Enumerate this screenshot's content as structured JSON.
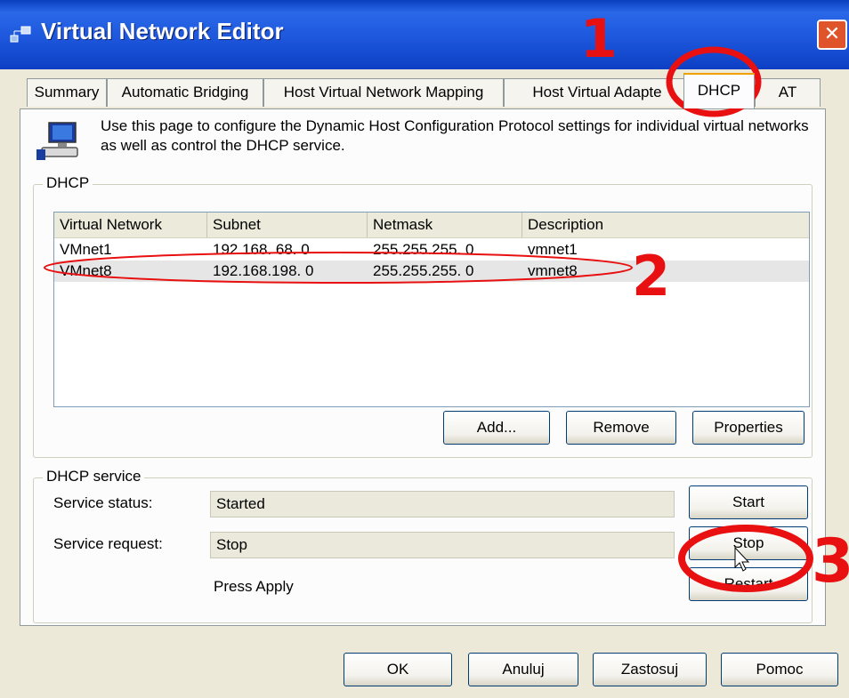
{
  "window": {
    "title": "Virtual Network Editor",
    "icon": "network-icon",
    "close_icon": "close-icon"
  },
  "tabs": [
    {
      "label": "Summary"
    },
    {
      "label": "Automatic Bridging"
    },
    {
      "label": "Host Virtual Network Mapping"
    },
    {
      "label": "Host Virtual Adapte"
    },
    {
      "label": "DHCP"
    },
    {
      "label": "AT"
    }
  ],
  "info": {
    "icon": "computer-icon",
    "text": "Use this page to configure the Dynamic Host Configuration Protocol settings for individual virtual networks as well as control the DHCP service."
  },
  "dhcp_group": {
    "label": "DHCP",
    "columns": [
      "Virtual Network",
      "Subnet",
      "Netmask",
      "Description"
    ],
    "rows": [
      [
        "VMnet1",
        "192.168. 68.  0",
        "255.255.255.  0",
        "vmnet1"
      ],
      [
        "VMnet8",
        "192.168.198.  0",
        "255.255.255.  0",
        "vmnet8"
      ]
    ],
    "buttons": {
      "add": "Add...",
      "remove": "Remove",
      "properties": "Properties"
    }
  },
  "service_group": {
    "label": "DHCP service",
    "status_label": "Service status:",
    "status_value": "Started",
    "request_label": "Service request:",
    "request_value": "Stop",
    "note": "Press Apply",
    "buttons": {
      "start": "Start",
      "stop": "Stop",
      "restart": "Restart"
    }
  },
  "footer_buttons": {
    "ok": "OK",
    "cancel": "Anuluj",
    "apply": "Zastosuj",
    "help": "Pomoc"
  },
  "annotations": {
    "step1": "1",
    "step2": "2",
    "step3": "3",
    "color": "#e81010"
  },
  "colors": {
    "titlebar": "#1d57dc",
    "panel": "#ece9d8",
    "selected_row": "#e6e6e6",
    "active_tab_accent": "#f0a000"
  }
}
